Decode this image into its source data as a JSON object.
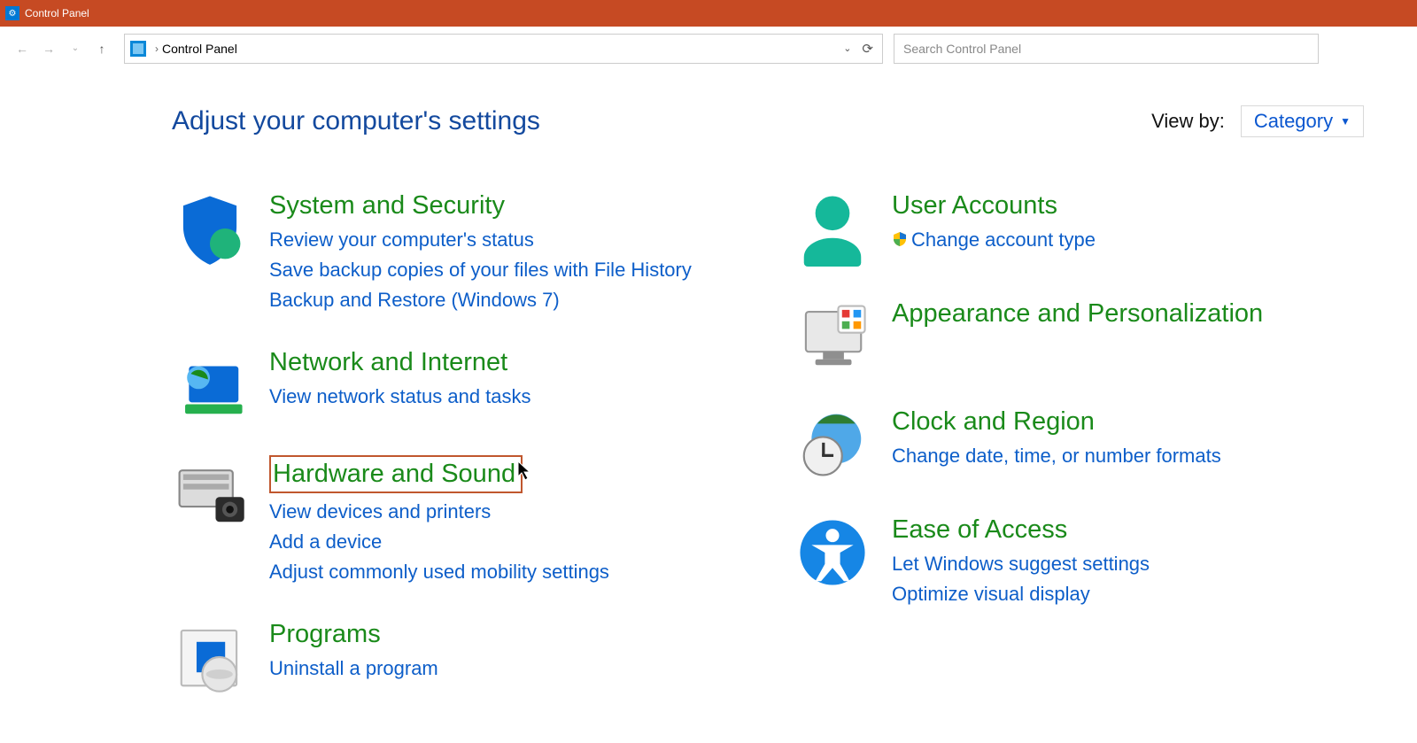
{
  "window": {
    "title": "Control Panel"
  },
  "address": {
    "crumb": "Control Panel"
  },
  "search": {
    "placeholder": "Search Control Panel"
  },
  "header": {
    "title": "Adjust your computer's settings"
  },
  "viewby": {
    "label": "View by:",
    "value": "Category"
  },
  "left": [
    {
      "title": "System and Security",
      "icon": "security-icon",
      "highlighted": false,
      "links": [
        "Review your computer's status",
        "Save backup copies of your files with File History",
        "Backup and Restore (Windows 7)"
      ]
    },
    {
      "title": "Network and Internet",
      "icon": "network-icon",
      "highlighted": false,
      "links": [
        "View network status and tasks"
      ]
    },
    {
      "title": "Hardware and Sound",
      "icon": "hardware-icon",
      "highlighted": true,
      "links": [
        "View devices and printers",
        "Add a device",
        "Adjust commonly used mobility settings"
      ]
    },
    {
      "title": "Programs",
      "icon": "programs-icon",
      "highlighted": false,
      "links": [
        "Uninstall a program"
      ]
    }
  ],
  "right": [
    {
      "title": "User Accounts",
      "icon": "user-icon",
      "highlighted": false,
      "links": [
        {
          "shield": true,
          "text": "Change account type"
        }
      ]
    },
    {
      "title": "Appearance and Personalization",
      "icon": "appearance-icon",
      "highlighted": false,
      "links": []
    },
    {
      "title": "Clock and Region",
      "icon": "clock-icon",
      "highlighted": false,
      "links": [
        "Change date, time, or number formats"
      ]
    },
    {
      "title": "Ease of Access",
      "icon": "access-icon",
      "highlighted": false,
      "links": [
        "Let Windows suggest settings",
        "Optimize visual display"
      ]
    }
  ]
}
